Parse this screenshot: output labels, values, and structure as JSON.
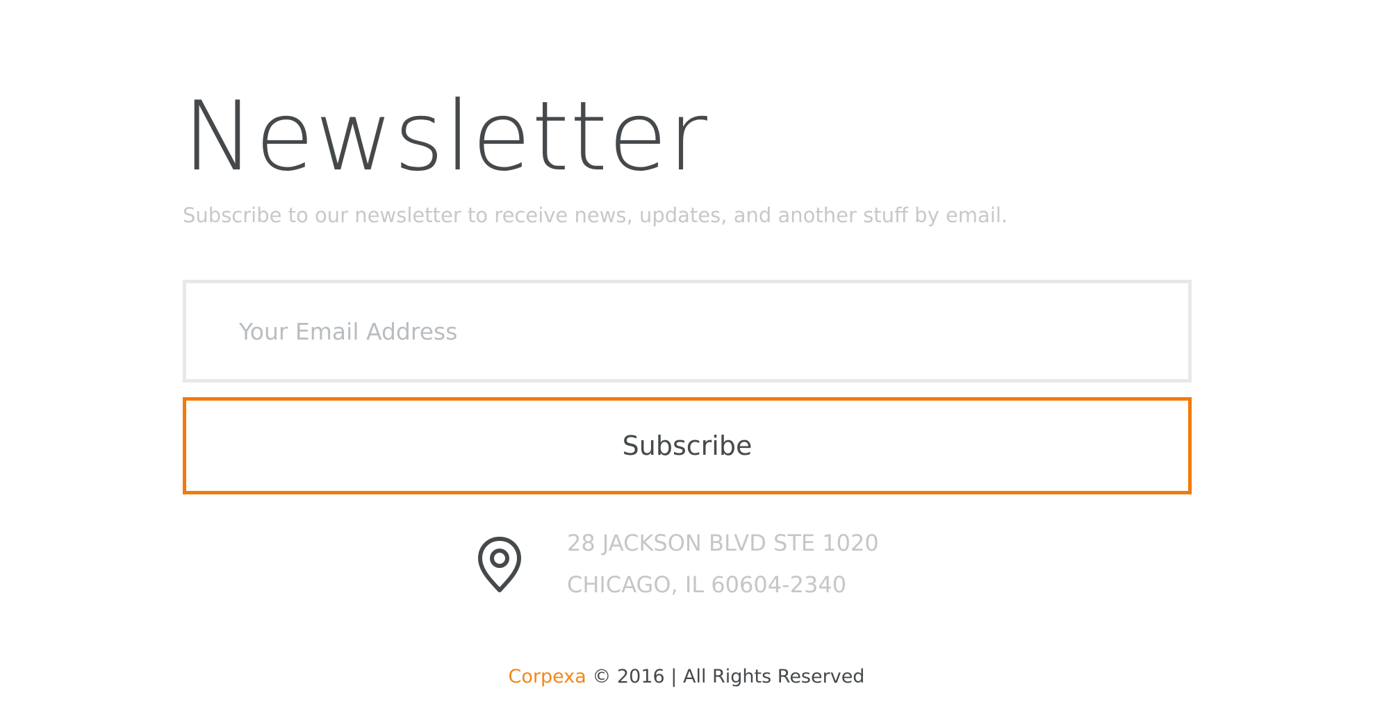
{
  "newsletter": {
    "title": "Newsletter",
    "subtitle": "Subscribe to our newsletter to receive news, updates, and another stuff by email.",
    "email_placeholder": "Your Email Address",
    "email_value": "",
    "subscribe_label": "Subscribe"
  },
  "address": {
    "icon": "location-pin-icon",
    "line1": "28 JACKSON BLVD STE 1020",
    "line2": "CHICAGO, IL 60604-2340"
  },
  "footer": {
    "brand": "Corpexa",
    "copyright_text": " © 2016 | All Rights Reserved"
  },
  "colors": {
    "accent": "#f27a0b",
    "brand_text": "#f2871a",
    "heading_text": "#45494c",
    "muted_text": "#c6c8ca",
    "input_border": "#e5e9eb"
  }
}
